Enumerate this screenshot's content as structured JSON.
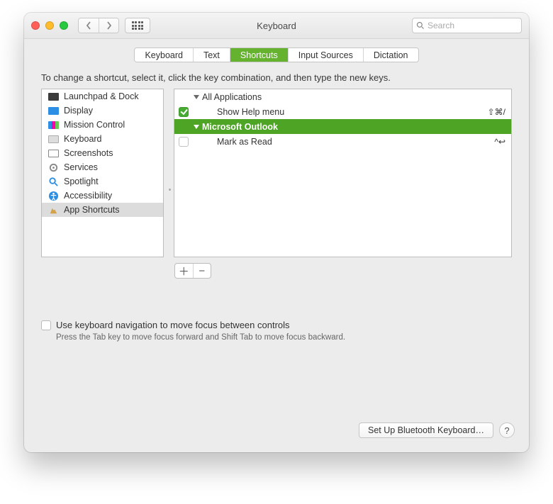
{
  "window": {
    "title": "Keyboard"
  },
  "search": {
    "placeholder": "Search"
  },
  "tabs": [
    "Keyboard",
    "Text",
    "Shortcuts",
    "Input Sources",
    "Dictation"
  ],
  "active_tab": "Shortcuts",
  "instruction": "To change a shortcut, select it, click the key combination, and then type the new keys.",
  "sidebar": {
    "items": [
      {
        "label": "Launchpad & Dock",
        "icon": "launchpad"
      },
      {
        "label": "Display",
        "icon": "display"
      },
      {
        "label": "Mission Control",
        "icon": "mission"
      },
      {
        "label": "Keyboard",
        "icon": "keyboard"
      },
      {
        "label": "Screenshots",
        "icon": "screenshots"
      },
      {
        "label": "Services",
        "icon": "gear"
      },
      {
        "label": "Spotlight",
        "icon": "magnifier"
      },
      {
        "label": "Accessibility",
        "icon": "accessibility"
      },
      {
        "label": "App Shortcuts",
        "icon": "app"
      }
    ],
    "selected_index": 8
  },
  "shortcut_list": {
    "rows": [
      {
        "type": "group",
        "label": "All Applications",
        "level": 0,
        "expanded": true
      },
      {
        "type": "item",
        "label": "Show Help menu",
        "level": 1,
        "checked": true,
        "keys": "⇧⌘/"
      },
      {
        "type": "group",
        "label": "Microsoft Outlook",
        "level": 0,
        "expanded": true,
        "highlight": true
      },
      {
        "type": "item",
        "label": "Mark as Read",
        "level": 1,
        "checked": false,
        "keys": "^↩"
      }
    ]
  },
  "kbnav": {
    "label": "Use keyboard navigation to move focus between controls",
    "hint": "Press the Tab key to move focus forward and Shift Tab to move focus backward."
  },
  "footer": {
    "bluetooth_btn": "Set Up Bluetooth Keyboard…"
  },
  "icons": {
    "launchpad": "#3b3b3b",
    "display": "#2d8fe4",
    "mission": "#555",
    "keyboard": "#888",
    "screenshots": "#888",
    "gear": "#888",
    "magnifier": "#2d8fe4",
    "accessibility": "#2d8fe4",
    "app": "#c99a3a"
  }
}
